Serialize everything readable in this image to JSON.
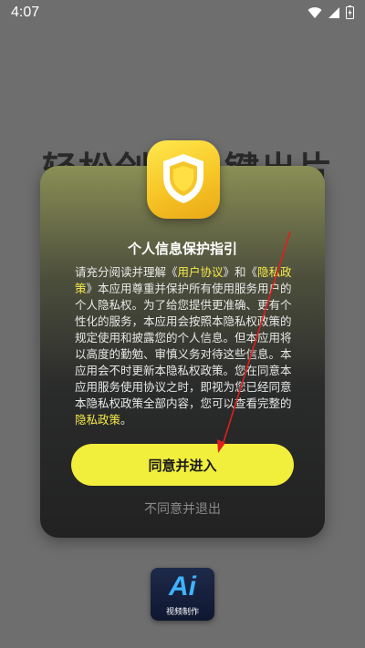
{
  "status_bar": {
    "time": "4:07",
    "icons": [
      "wifi-icon",
      "signal-icon",
      "battery-icon"
    ]
  },
  "background": {
    "title_text": "轻松创作一键出片"
  },
  "dialog": {
    "title": "个人信息保护指引",
    "body": {
      "p1": "请充分阅读并理解《",
      "link1": "用户协议",
      "p2": "》和《",
      "link2": "隐私政策",
      "p3": "》本应用尊重并保护所有使用服务用户的个人隐私权。为了给您提供更准确、更有个性化的服务，本应用会按照本隐私权政策的规定使用和披露您的个人信息。但本应用将以高度的勤勉、审慎义务对待这些信息。本应用会不时更新本隐私权政策。您在同意本应用服务使用协议之时，即视为您已经同意本隐私权政策全部内容，您可以查看完整的",
      "link3": "隐私政策",
      "p4": "。"
    },
    "agree_label": "同意并进入",
    "disagree_label": "不同意并退出"
  },
  "app_logo": {
    "main": "Ai",
    "sub": "视频制作"
  },
  "colors": {
    "accent": "#f2ee3c",
    "link": "#f5e94b",
    "badge": "#f7c526",
    "arrow": "#e01f1f"
  }
}
